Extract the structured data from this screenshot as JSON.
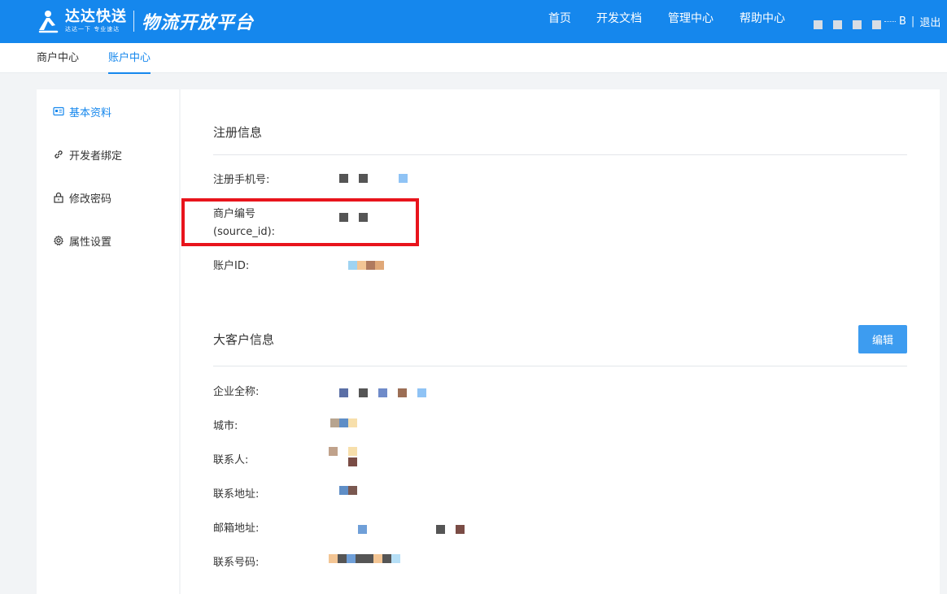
{
  "header": {
    "brand": "达达快送",
    "slogan": "达达一下 专业速达",
    "platform": "物流开放平台",
    "nav": [
      "首页",
      "开发文档",
      "管理中心",
      "帮助中心"
    ],
    "user_suffix": "B",
    "separator": "|",
    "logout": "退出",
    "bg_color": "#1587ed"
  },
  "subnav": {
    "tabs": [
      {
        "label": "商户中心",
        "active": false
      },
      {
        "label": "账户中心",
        "active": true
      }
    ]
  },
  "sidebar": {
    "items": [
      {
        "label": "基本资料",
        "icon": "id-card-icon",
        "active": true
      },
      {
        "label": "开发者绑定",
        "icon": "link-icon",
        "active": false
      },
      {
        "label": "修改密码",
        "icon": "lock-icon",
        "active": false
      },
      {
        "label": "属性设置",
        "icon": "gear-icon",
        "active": false
      }
    ]
  },
  "registration": {
    "title": "注册信息",
    "fields": [
      {
        "label": "注册手机号:"
      },
      {
        "label_line1": "商户编号",
        "label_line2": "(source_id):"
      },
      {
        "label": "账户ID:"
      }
    ]
  },
  "enterprise": {
    "title": "大客户信息",
    "edit_label": "编辑",
    "fields": [
      {
        "label": "企业全称:"
      },
      {
        "label": "城市:"
      },
      {
        "label": "联系人:"
      },
      {
        "label": "联系地址:"
      },
      {
        "label": "邮箱地址:"
      },
      {
        "label": "联系号码:"
      }
    ]
  },
  "colors": {
    "accent": "#1587ed",
    "highlight": "#e8141c",
    "button": "#3d9cf0"
  }
}
